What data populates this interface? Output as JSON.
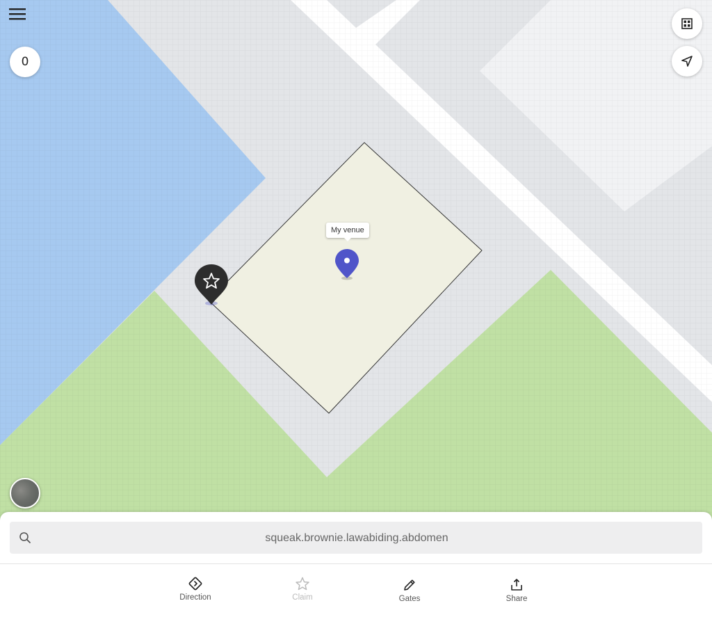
{
  "colors": {
    "water": "#a6c9f0",
    "park": "#c0e0a4",
    "road": "#ffffff",
    "ground": "#e3e5e8",
    "block": "#f1f2f4",
    "venue_fill": "#f0f0e2",
    "venue_pin": "#5055c9",
    "star_pin": "#2d2d2d"
  },
  "map": {
    "counter_value": "0",
    "venue_label": "My venue",
    "icons": {
      "menu": "hamburger-menu-icon",
      "layers": "grid-icon",
      "locate": "navigation-arrow-icon",
      "venue_marker": "map-pin-icon",
      "claimed_marker": "star-icon"
    }
  },
  "search": {
    "value": "squeak.brownie.lawabiding.abdomen",
    "icon": "search-icon"
  },
  "actions": [
    {
      "label": "Direction",
      "icon": "direction-icon",
      "enabled": true
    },
    {
      "label": "Claim",
      "icon": "star-icon",
      "enabled": false
    },
    {
      "label": "Gates",
      "icon": "pencil-icon",
      "enabled": true
    },
    {
      "label": "Share",
      "icon": "share-icon",
      "enabled": true
    }
  ]
}
